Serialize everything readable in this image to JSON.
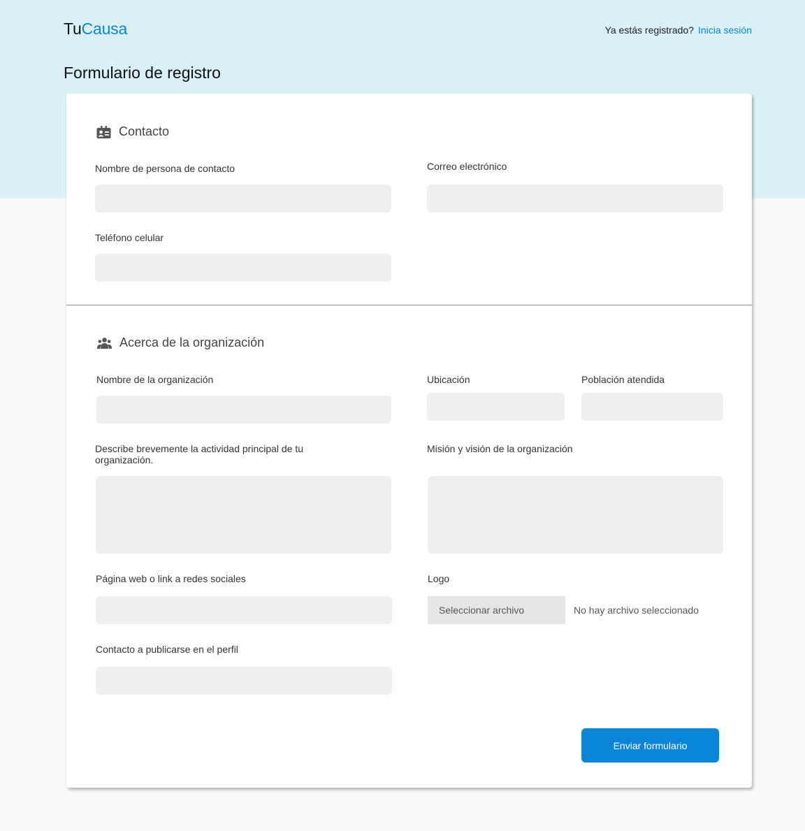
{
  "brand": {
    "part1": "Tu",
    "part2": "Causa"
  },
  "header": {
    "login_prompt": "Ya estás registrado?",
    "login_link": "Inicia sesión"
  },
  "page_title": "Formulario de registro",
  "colors": {
    "band": "#d8f0f6",
    "accent": "#0a84d6",
    "field_bg": "#efefef"
  },
  "contact": {
    "title": "Contacto",
    "icon": "contact-card-icon",
    "fields": {
      "name": {
        "label": "Nombre de persona de contacto",
        "value": ""
      },
      "email": {
        "label": "Correo electrónico",
        "value": ""
      },
      "phone": {
        "label": "Teléfono celular",
        "value": ""
      }
    }
  },
  "organization": {
    "title": "Acerca de la organización",
    "icon": "group-icon",
    "fields": {
      "org_name": {
        "label": "Nombre de la organización",
        "value": ""
      },
      "location": {
        "label": "Ubicación",
        "value": ""
      },
      "population": {
        "label": "Población atendida",
        "value": ""
      },
      "activity": {
        "label": "Describe brevemente la actividad principal de tu organización.",
        "value": ""
      },
      "mission": {
        "label": "Misión y visión de la organización",
        "value": ""
      },
      "website": {
        "label": "Página web o link a redes sociales",
        "value": ""
      },
      "logo": {
        "label": "Logo",
        "button": "Seleccionar archivo",
        "status": "No hay archivo seleccionado"
      },
      "public_contact": {
        "label": "Contacto a publicarse en el perfil",
        "value": ""
      }
    }
  },
  "submit_label": "Enviar formulario"
}
